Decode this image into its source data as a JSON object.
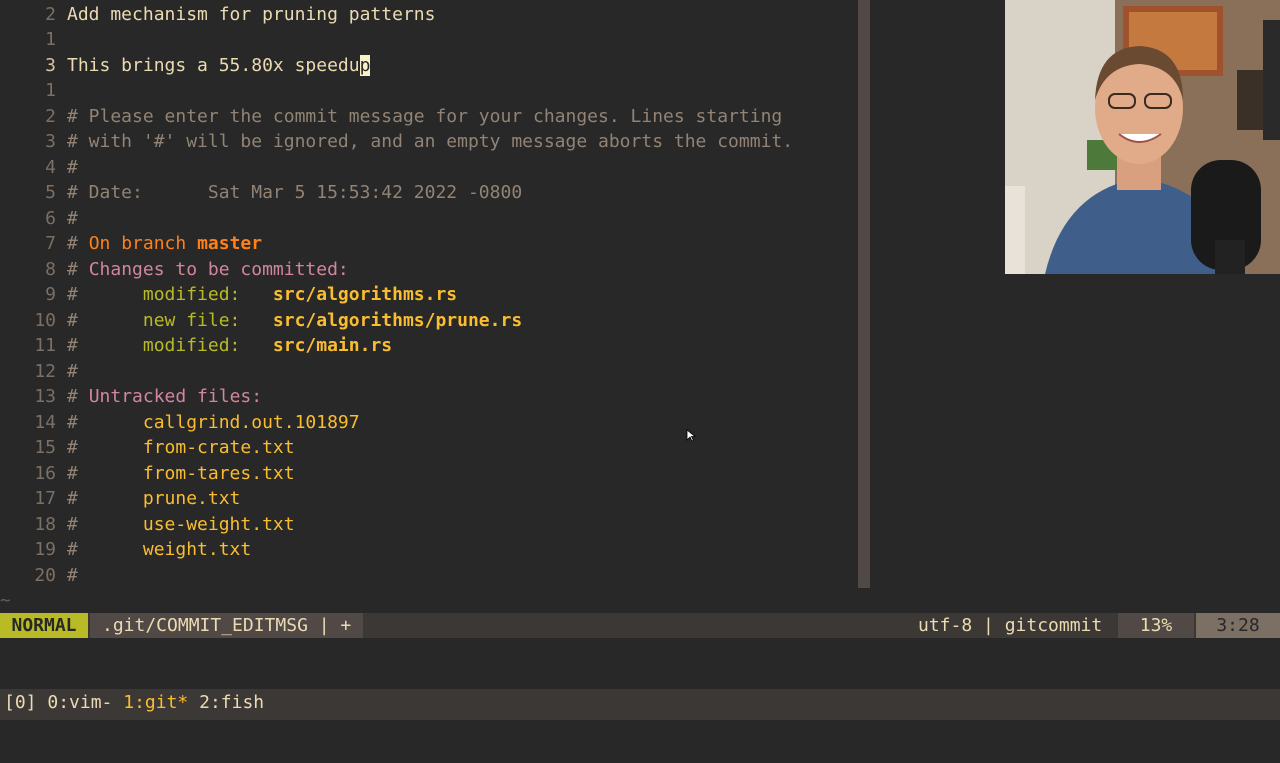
{
  "editor": {
    "lines": [
      {
        "num": "2",
        "segments": [
          {
            "t": "Add mechanism for pruning patterns",
            "c": "c-default"
          }
        ]
      },
      {
        "num": "1",
        "segments": []
      },
      {
        "num": "3",
        "current": true,
        "segments": [
          {
            "t": "This brings a 55.80x speedu",
            "c": "c-default"
          },
          {
            "t": "p",
            "c": "cursor-box"
          }
        ]
      },
      {
        "num": "1",
        "segments": []
      },
      {
        "num": "2",
        "segments": [
          {
            "t": "# Please enter the commit message for your changes. Lines starting",
            "c": "c-comment"
          }
        ]
      },
      {
        "num": "3",
        "segments": [
          {
            "t": "# with '#' will be ignored, and an empty message aborts the commit.",
            "c": "c-comment"
          }
        ]
      },
      {
        "num": "4",
        "segments": [
          {
            "t": "#",
            "c": "c-comment"
          }
        ]
      },
      {
        "num": "5",
        "segments": [
          {
            "t": "# Date:      Sat Mar 5 15:53:42 2022 -0800",
            "c": "c-comment"
          }
        ]
      },
      {
        "num": "6",
        "segments": [
          {
            "t": "#",
            "c": "c-comment"
          }
        ]
      },
      {
        "num": "7",
        "segments": [
          {
            "t": "# ",
            "c": "c-comment"
          },
          {
            "t": "On branch ",
            "c": "c-orange"
          },
          {
            "t": "master",
            "c": "c-branch"
          }
        ]
      },
      {
        "num": "8",
        "segments": [
          {
            "t": "# ",
            "c": "c-comment"
          },
          {
            "t": "Changes to be committed:",
            "c": "c-pink"
          }
        ]
      },
      {
        "num": "9",
        "segments": [
          {
            "t": "#      ",
            "c": "c-comment"
          },
          {
            "t": "modified:   ",
            "c": "c-green"
          },
          {
            "t": "src/algorithms.rs",
            "c": "c-file"
          }
        ]
      },
      {
        "num": "10",
        "segments": [
          {
            "t": "#      ",
            "c": "c-comment"
          },
          {
            "t": "new file:   ",
            "c": "c-green"
          },
          {
            "t": "src/algorithms/prune.rs",
            "c": "c-file"
          }
        ]
      },
      {
        "num": "11",
        "segments": [
          {
            "t": "#      ",
            "c": "c-comment"
          },
          {
            "t": "modified:   ",
            "c": "c-green"
          },
          {
            "t": "src/main.rs",
            "c": "c-file"
          }
        ]
      },
      {
        "num": "12",
        "segments": [
          {
            "t": "#",
            "c": "c-comment"
          }
        ]
      },
      {
        "num": "13",
        "segments": [
          {
            "t": "# ",
            "c": "c-comment"
          },
          {
            "t": "Untracked files:",
            "c": "c-pink"
          }
        ]
      },
      {
        "num": "14",
        "segments": [
          {
            "t": "#      ",
            "c": "c-comment"
          },
          {
            "t": "callgrind.out.101897",
            "c": "c-untracked"
          }
        ]
      },
      {
        "num": "15",
        "segments": [
          {
            "t": "#      ",
            "c": "c-comment"
          },
          {
            "t": "from-crate.txt",
            "c": "c-untracked"
          }
        ]
      },
      {
        "num": "16",
        "segments": [
          {
            "t": "#      ",
            "c": "c-comment"
          },
          {
            "t": "from-tares.txt",
            "c": "c-untracked"
          }
        ]
      },
      {
        "num": "17",
        "segments": [
          {
            "t": "#      ",
            "c": "c-comment"
          },
          {
            "t": "prune.txt",
            "c": "c-untracked"
          }
        ]
      },
      {
        "num": "18",
        "segments": [
          {
            "t": "#      ",
            "c": "c-comment"
          },
          {
            "t": "use-weight.txt",
            "c": "c-untracked"
          }
        ]
      },
      {
        "num": "19",
        "segments": [
          {
            "t": "#      ",
            "c": "c-comment"
          },
          {
            "t": "weight.txt",
            "c": "c-untracked"
          }
        ]
      },
      {
        "num": "20",
        "segments": [
          {
            "t": "#",
            "c": "c-comment"
          }
        ]
      }
    ],
    "tilde": "~"
  },
  "statusline": {
    "mode": "NORMAL",
    "file": ".git/COMMIT_EDITMSG | +",
    "encoding": "utf-8 | gitcommit",
    "percent": "13%",
    "position": "3:28"
  },
  "tmux": {
    "session": "[0]",
    "windows": [
      {
        "label": "0:vim-",
        "current": false
      },
      {
        "label": "1:git*",
        "current": true
      },
      {
        "label": "2:fish",
        "current": false
      }
    ]
  },
  "colors": {
    "background": "#282828",
    "mode_normal": "#b8bb26",
    "statusline": "#3c3836",
    "current_window": "#fabd2f"
  },
  "icons": {
    "webcam": "person-webcam-overlay",
    "mouse": "mouse-pointer-icon"
  }
}
